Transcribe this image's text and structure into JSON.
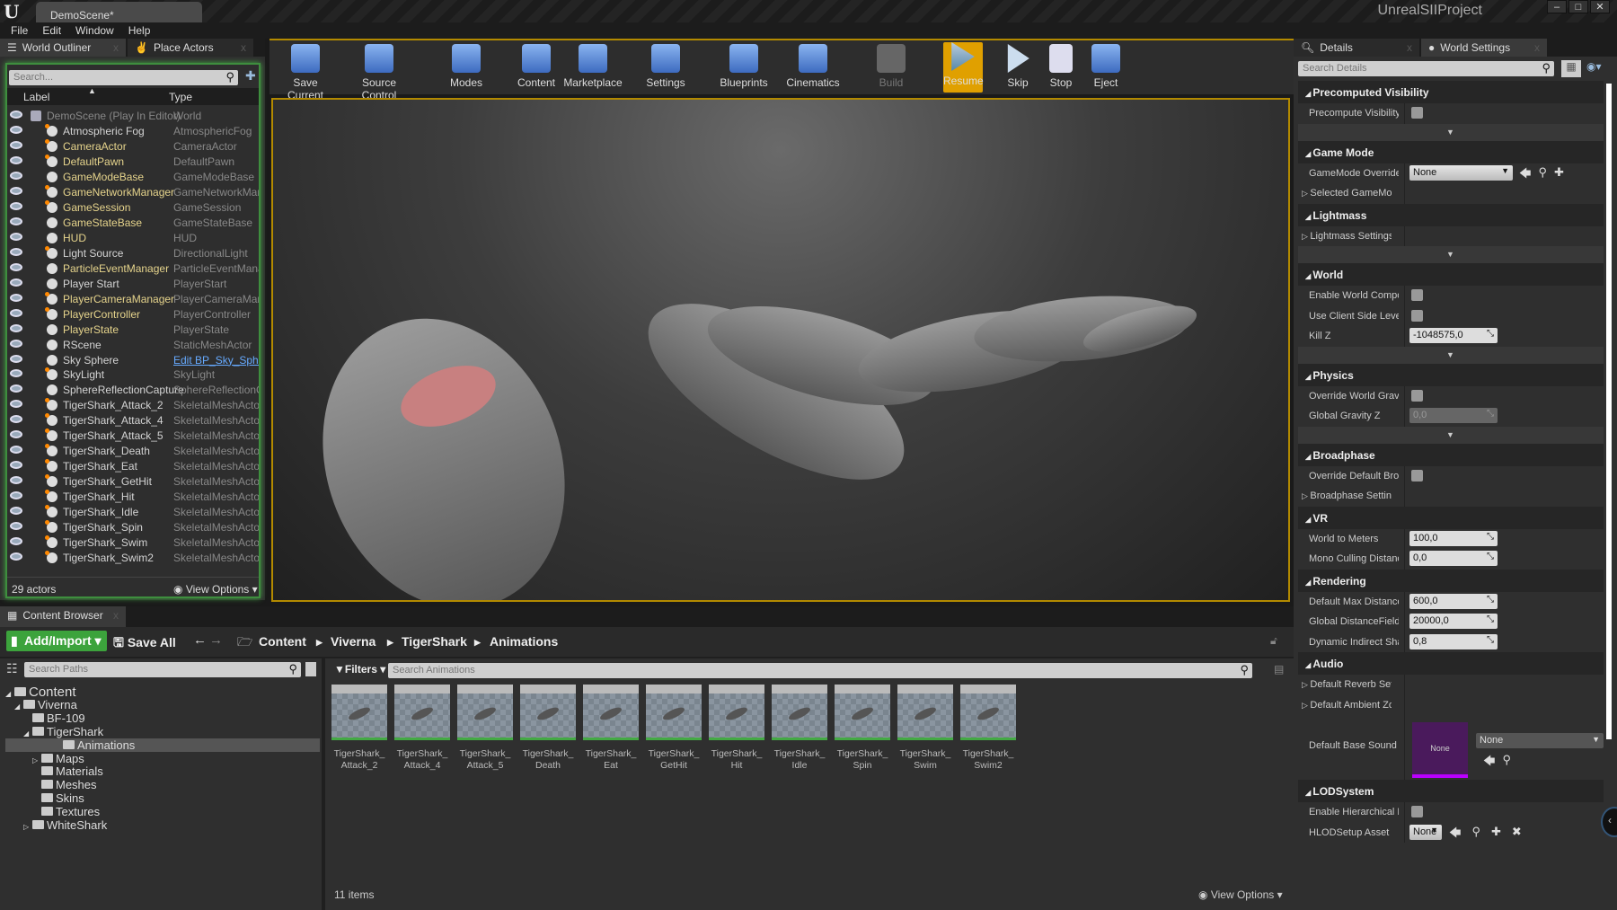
{
  "app": {
    "doc_tab": "DemoScene*",
    "project": "UnrealSIIProject",
    "logo": "U"
  },
  "menu": [
    "File",
    "Edit",
    "Window",
    "Help"
  ],
  "outliner": {
    "tabs": [
      {
        "label": "World Outliner"
      },
      {
        "label": "Place Actors"
      }
    ],
    "search_placeholder": "Search...",
    "col_label": "Label",
    "col_type": "Type",
    "rows": [
      {
        "label": "DemoScene (Play In Editor)",
        "type": "World",
        "style": "world"
      },
      {
        "label": "Atmospheric Fog",
        "type": "AtmosphericFog",
        "style": "plain",
        "dot": true
      },
      {
        "label": "CameraActor",
        "type": "CameraActor",
        "style": "yellow",
        "dot": true
      },
      {
        "label": "DefaultPawn",
        "type": "DefaultPawn",
        "style": "yellow",
        "dot": true
      },
      {
        "label": "GameModeBase",
        "type": "GameModeBase",
        "style": "yellow"
      },
      {
        "label": "GameNetworkManager",
        "type": "GameNetworkManager",
        "style": "yellow",
        "dot": true
      },
      {
        "label": "GameSession",
        "type": "GameSession",
        "style": "yellow",
        "dot": true
      },
      {
        "label": "GameStateBase",
        "type": "GameStateBase",
        "style": "yellow"
      },
      {
        "label": "HUD",
        "type": "HUD",
        "style": "yellow"
      },
      {
        "label": "Light Source",
        "type": "DirectionalLight",
        "style": "plain",
        "dot": true
      },
      {
        "label": "ParticleEventManager",
        "type": "ParticleEventManager",
        "style": "yellow"
      },
      {
        "label": "Player Start",
        "type": "PlayerStart",
        "style": "plain"
      },
      {
        "label": "PlayerCameraManager",
        "type": "PlayerCameraManager",
        "style": "yellow",
        "dot": true
      },
      {
        "label": "PlayerController",
        "type": "PlayerController",
        "style": "yellow",
        "dot": true
      },
      {
        "label": "PlayerState",
        "type": "PlayerState",
        "style": "yellow"
      },
      {
        "label": "RScene",
        "type": "StaticMeshActor",
        "style": "plain"
      },
      {
        "label": "Sky Sphere",
        "type": "Edit BP_Sky_Sphere",
        "style": "plain",
        "link": true
      },
      {
        "label": "SkyLight",
        "type": "SkyLight",
        "style": "plain",
        "dot": true
      },
      {
        "label": "SphereReflectionCapture",
        "type": "SphereReflectionCapture",
        "style": "plain"
      },
      {
        "label": "TigerShark_Attack_2",
        "type": "SkeletalMeshActor",
        "style": "plain",
        "dot": true
      },
      {
        "label": "TigerShark_Attack_4",
        "type": "SkeletalMeshActor",
        "style": "plain",
        "dot": true
      },
      {
        "label": "TigerShark_Attack_5",
        "type": "SkeletalMeshActor",
        "style": "plain",
        "dot": true
      },
      {
        "label": "TigerShark_Death",
        "type": "SkeletalMeshActor",
        "style": "plain",
        "dot": true
      },
      {
        "label": "TigerShark_Eat",
        "type": "SkeletalMeshActor",
        "style": "plain",
        "dot": true
      },
      {
        "label": "TigerShark_GetHit",
        "type": "SkeletalMeshActor",
        "style": "plain",
        "dot": true
      },
      {
        "label": "TigerShark_Hit",
        "type": "SkeletalMeshActor",
        "style": "plain",
        "dot": true
      },
      {
        "label": "TigerShark_Idle",
        "type": "SkeletalMeshActor",
        "style": "plain",
        "dot": true
      },
      {
        "label": "TigerShark_Spin",
        "type": "SkeletalMeshActor",
        "style": "plain",
        "dot": true
      },
      {
        "label": "TigerShark_Swim",
        "type": "SkeletalMeshActor",
        "style": "plain",
        "dot": true
      },
      {
        "label": "TigerShark_Swim2",
        "type": "SkeletalMeshActor",
        "style": "plain",
        "dot": true
      }
    ],
    "actor_count": "29 actors",
    "view_options": "View Options"
  },
  "toolbar": {
    "buttons": [
      {
        "label": "Save Current",
        "icon": "save-icon"
      },
      {
        "label": "Source Control",
        "icon": "source-control-icon"
      },
      {
        "label": "Modes",
        "icon": "modes-icon"
      },
      {
        "label": "Content",
        "icon": "content-icon"
      },
      {
        "label": "Marketplace",
        "icon": "marketplace-icon"
      },
      {
        "label": "Settings",
        "icon": "settings-icon"
      },
      {
        "label": "Blueprints",
        "icon": "blueprints-icon"
      },
      {
        "label": "Cinematics",
        "icon": "cinematics-icon"
      },
      {
        "label": "Build",
        "icon": "build-icon",
        "disabled": true
      },
      {
        "label": "Resume",
        "icon": "resume-icon",
        "active": true
      },
      {
        "label": "Skip",
        "icon": "skip-icon"
      },
      {
        "label": "Stop",
        "icon": "stop-icon"
      },
      {
        "label": "Eject",
        "icon": "eject-icon"
      }
    ]
  },
  "details": {
    "tabs": [
      {
        "label": "Details"
      },
      {
        "label": "World Settings"
      }
    ],
    "search_placeholder": "Search Details",
    "rows": [
      {
        "kind": "header",
        "label": "Precomputed Visibility"
      },
      {
        "kind": "check",
        "label": "Precompute Visibility"
      },
      {
        "kind": "expander"
      },
      {
        "kind": "header",
        "label": "Game Mode"
      },
      {
        "kind": "dropdown",
        "label": "GameMode Override",
        "value": "None"
      },
      {
        "kind": "group",
        "label": "Selected GameMode"
      },
      {
        "kind": "header",
        "label": "Lightmass"
      },
      {
        "kind": "group",
        "label": "Lightmass Settings"
      },
      {
        "kind": "expander"
      },
      {
        "kind": "header",
        "label": "World"
      },
      {
        "kind": "check",
        "label": "Enable World Composition"
      },
      {
        "kind": "check",
        "label": "Use Client Side Level Streaming Volumes"
      },
      {
        "kind": "number",
        "label": "Kill Z",
        "value": "-1048575,0"
      },
      {
        "kind": "expander"
      },
      {
        "kind": "header",
        "label": "Physics"
      },
      {
        "kind": "check",
        "label": "Override World Gravity"
      },
      {
        "kind": "number",
        "label": "Global Gravity Z",
        "value": "0,0",
        "disabled": true
      },
      {
        "kind": "expander"
      },
      {
        "kind": "header",
        "label": "Broadphase"
      },
      {
        "kind": "check",
        "label": "Override Default Broadphase Settings"
      },
      {
        "kind": "group",
        "label": "Broadphase Settings"
      },
      {
        "kind": "header",
        "label": "VR"
      },
      {
        "kind": "number",
        "label": "World to Meters",
        "value": "100,0"
      },
      {
        "kind": "number",
        "label": "Mono Culling Distance",
        "value": "0,0"
      },
      {
        "kind": "header",
        "label": "Rendering"
      },
      {
        "kind": "number",
        "label": "Default Max DistanceField Occlusion Distance",
        "value": "600,0"
      },
      {
        "kind": "number",
        "label": "Global DistanceField View Distance",
        "value": "20000,0"
      },
      {
        "kind": "number",
        "label": "Dynamic Indirect Shadows Self Shadowing Intensity",
        "value": "0,8"
      },
      {
        "kind": "header",
        "label": "Audio"
      },
      {
        "kind": "group",
        "label": "Default Reverb Settings"
      },
      {
        "kind": "group",
        "label": "Default Ambient Zone Settings"
      },
      {
        "kind": "sound",
        "label": "Default Base Sound Mix",
        "thumb": "None",
        "value": "None"
      },
      {
        "kind": "header",
        "label": "LODSystem"
      },
      {
        "kind": "check",
        "label": "Enable Hierarchical LOD System"
      },
      {
        "kind": "asset",
        "label": "HLODSetup Asset",
        "value": "None"
      }
    ]
  },
  "content_browser": {
    "tab": "Content Browser",
    "add_import": "Add/Import",
    "save_all": "Save All",
    "breadcrumb": [
      "Content",
      "Viverna",
      "TigerShark",
      "Animations"
    ],
    "path_search_placeholder": "Search Paths",
    "filters": "Filters",
    "asset_search_placeholder": "Search Animations",
    "tree": [
      {
        "label": "Content",
        "depth": 0,
        "open": true
      },
      {
        "label": "Viverna",
        "depth": 1,
        "open": true
      },
      {
        "label": "BF-109",
        "depth": 2
      },
      {
        "label": "TigerShark",
        "depth": 2,
        "open": true
      },
      {
        "label": "Animations",
        "depth": 3,
        "selected": true
      },
      {
        "label": "Maps",
        "depth": 3,
        "collapsed": true
      },
      {
        "label": "Materials",
        "depth": 3
      },
      {
        "label": "Meshes",
        "depth": 3
      },
      {
        "label": "Skins",
        "depth": 3
      },
      {
        "label": "Textures",
        "depth": 3
      },
      {
        "label": "WhiteShark",
        "depth": 2,
        "collapsed": true
      }
    ],
    "assets": [
      [
        "TigerShark_",
        "Attack_2"
      ],
      [
        "TigerShark_",
        "Attack_4"
      ],
      [
        "TigerShark_",
        "Attack_5"
      ],
      [
        "TigerShark_",
        "Death"
      ],
      [
        "TigerShark_",
        "Eat"
      ],
      [
        "TigerShark_",
        "GetHit"
      ],
      [
        "TigerShark_",
        "Hit"
      ],
      [
        "TigerShark_",
        "Idle"
      ],
      [
        "TigerShark_",
        "Spin"
      ],
      [
        "TigerShark_",
        "Swim"
      ],
      [
        "TigerShark_",
        "Swim2"
      ]
    ],
    "item_count": "11 items",
    "view_options": "View Options"
  },
  "colors": {
    "accent": "#e0a000",
    "outliner_border": "#3e8e3e",
    "add_import": "#3ca33c",
    "actor_yellow": "#e6d48c",
    "sound_mix": "#4a1a5c"
  }
}
